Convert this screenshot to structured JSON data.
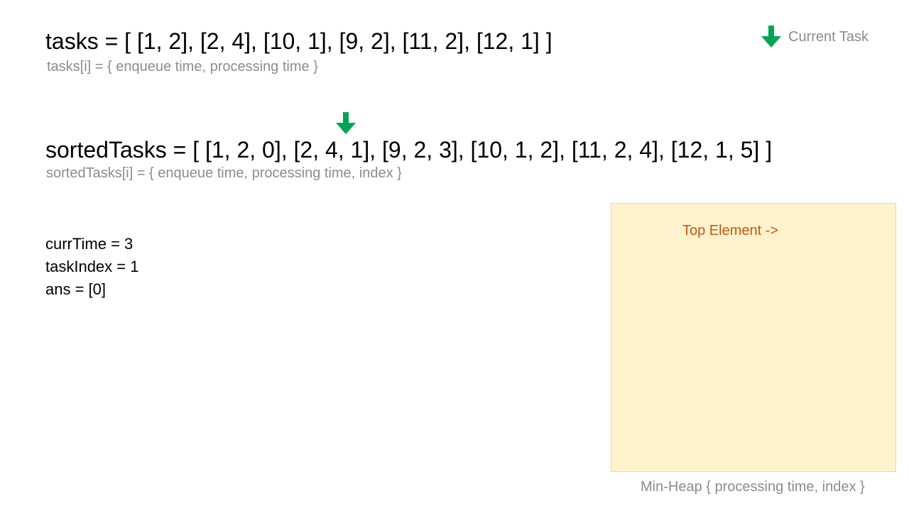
{
  "tasks": {
    "expression": "tasks = [ [1, 2], [2, 4], [10, 1], [9, 2], [11, 2], [12, 1] ]",
    "caption": "tasks[i] = { enqueue time, processing time }"
  },
  "legend": {
    "icon": "green-down-arrow",
    "label": "Current Task"
  },
  "sorted_tasks": {
    "expression": "sortedTasks = [ [1, 2, 0], [2, 4, 1], [9, 2, 3], [10, 1, 2], [11, 2, 4], [12, 1, 5] ]",
    "caption": "sortedTasks[i] = { enqueue time, processing time, index }"
  },
  "state": {
    "curr_time": "currTime = 3",
    "task_index": "taskIndex = 1",
    "ans": "ans = [0]"
  },
  "heap": {
    "top_label": "Top Element ->",
    "caption": "Min-Heap  { processing time, index }"
  },
  "colors": {
    "arrow": "#00a651",
    "heap_fill": "#fff2cc",
    "heap_label": "#c55a11",
    "caption_gray": "#8c8c8c"
  }
}
